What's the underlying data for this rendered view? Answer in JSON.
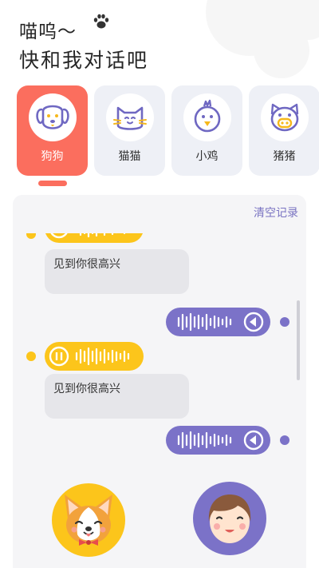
{
  "header": {
    "title_line1": "喵呜～",
    "title_line2": "快和我对话吧"
  },
  "animals": [
    {
      "label": "狗狗",
      "icon": "dog-icon",
      "active": true
    },
    {
      "label": "猫猫",
      "icon": "cat-icon",
      "active": false
    },
    {
      "label": "小鸡",
      "icon": "chick-icon",
      "active": false
    },
    {
      "label": "猪猪",
      "icon": "pig-icon",
      "active": false
    }
  ],
  "chat": {
    "clear_label": "清空记录",
    "messages": [
      {
        "from": "animal",
        "type": "voice"
      },
      {
        "from": "animal",
        "type": "text",
        "text": "见到你很高兴"
      },
      {
        "from": "human",
        "type": "voice"
      },
      {
        "from": "animal",
        "type": "voice"
      },
      {
        "from": "animal",
        "type": "text",
        "text": "见到你很高兴"
      },
      {
        "from": "human",
        "type": "voice"
      }
    ]
  },
  "avatars": {
    "animal": "corgi-avatar",
    "human": "boy-avatar"
  },
  "colors": {
    "accent": "#fb6e5e",
    "animal_voice": "#fcc51b",
    "human_voice": "#7b72c8",
    "card_bg": "#eef0f6",
    "link": "#7a74c2"
  }
}
